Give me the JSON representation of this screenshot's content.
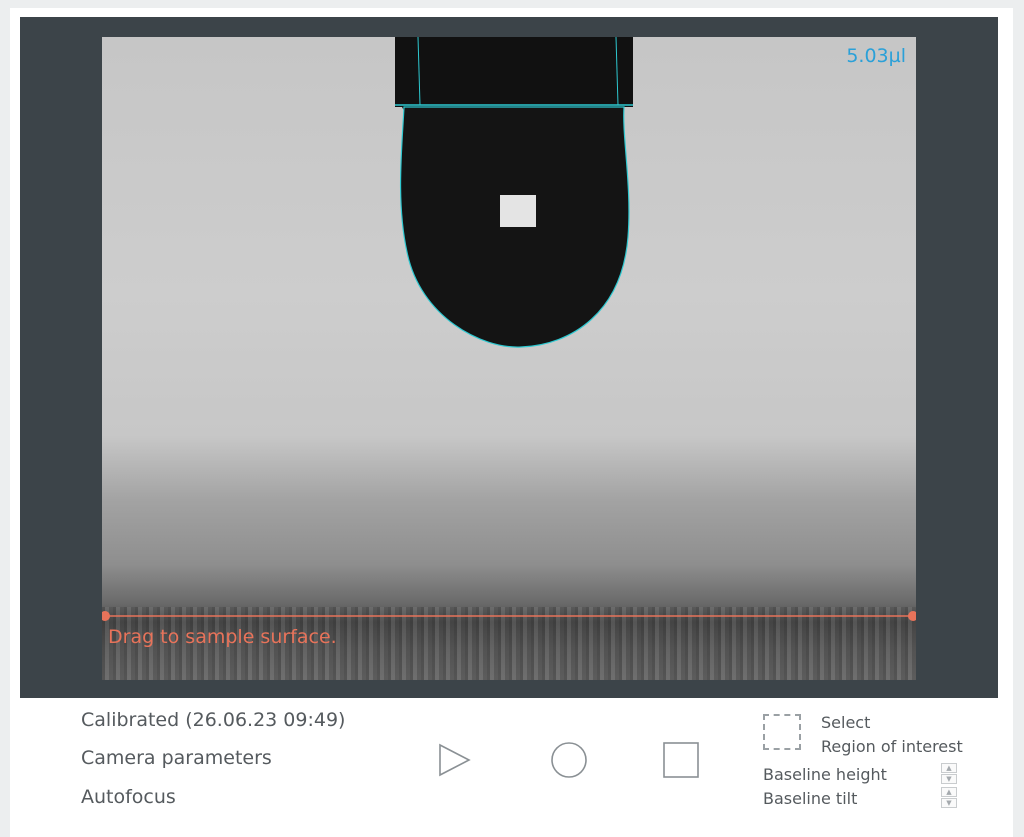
{
  "viewer": {
    "volume_readout": "5.03µl",
    "baseline_hint": "Drag to sample surface."
  },
  "info": {
    "calibration": "Calibrated (26.06.23 09:49)",
    "camera_parameters": "Camera parameters",
    "autofocus": "Autofocus"
  },
  "controls": {
    "play": "play-icon",
    "record": "record-icon",
    "stop": "stop-icon"
  },
  "roi": {
    "select": "Select",
    "region": "Region of interest"
  },
  "baseline": {
    "height_label": "Baseline height",
    "tilt_label": "Baseline tilt"
  },
  "colors": {
    "accent_blue": "#2aa0d8",
    "baseline_orange": "#e8735a",
    "contour_cyan": "#2ec8d0"
  }
}
